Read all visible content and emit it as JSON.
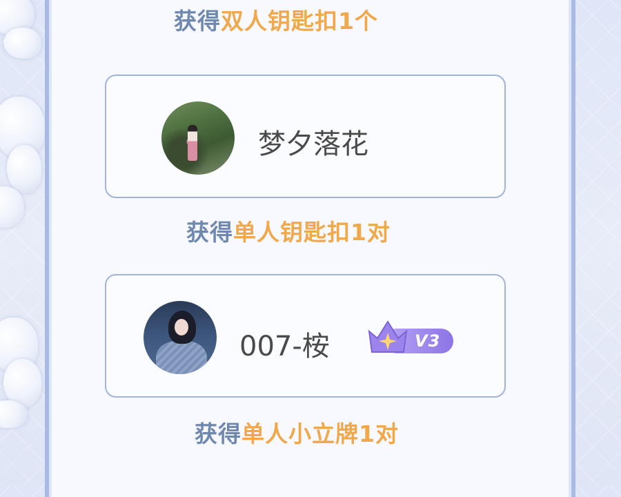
{
  "prizes": [
    {
      "prefix": "获得",
      "item": "双人钥匙扣1个"
    },
    {
      "prefix": "获得",
      "item": "单人钥匙扣1对"
    },
    {
      "prefix": "获得",
      "item": "单人小立牌1对"
    }
  ],
  "winners": [
    {
      "name": "梦夕落花",
      "avatar": "avatar-photo-garden"
    },
    {
      "name": "007-桉",
      "avatar": "avatar-photo-portrait",
      "badge": "V3",
      "badge_icon": "crown-star-icon"
    }
  ],
  "colors": {
    "prefix": "#6f88b0",
    "item": "#f0a84a",
    "card_border": "#9fb3dc",
    "frame": "#a9b9e6"
  }
}
